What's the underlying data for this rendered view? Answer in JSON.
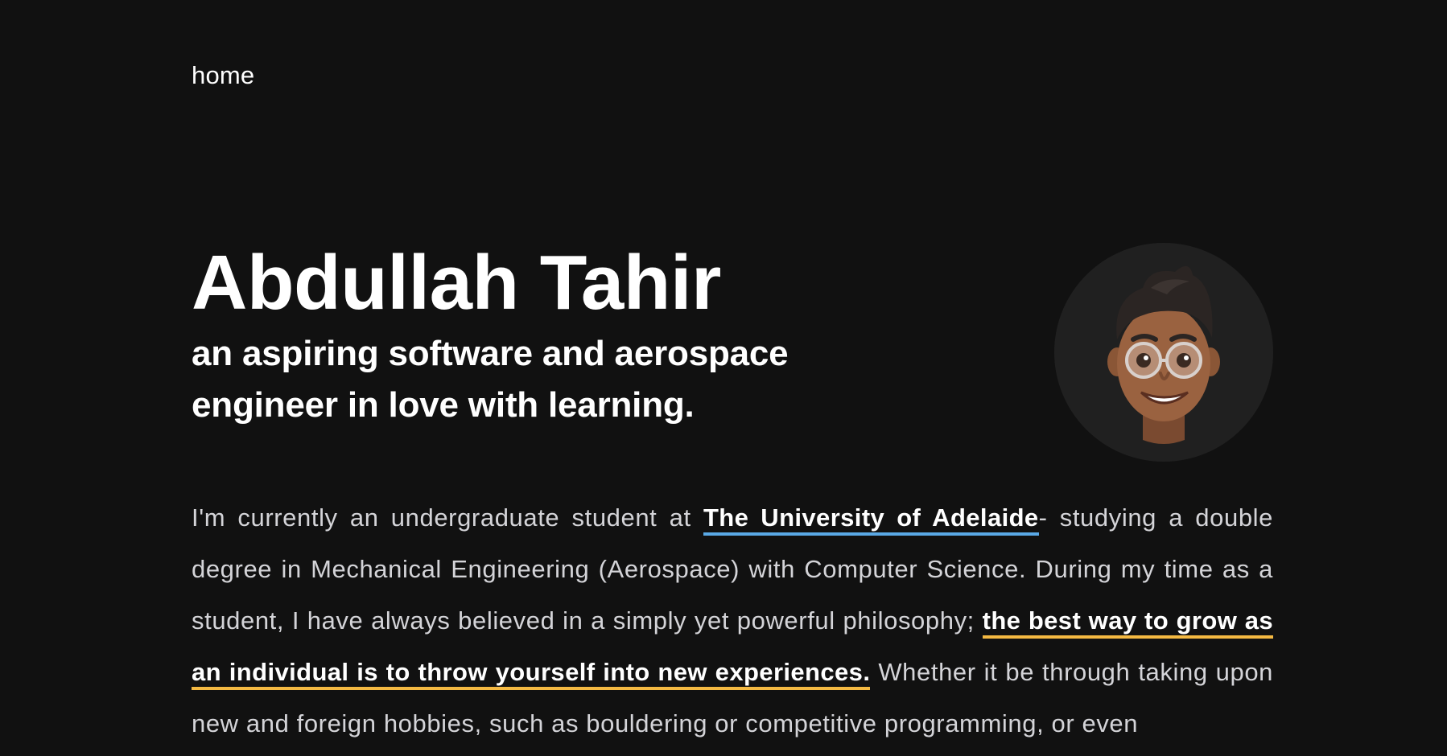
{
  "nav": {
    "home_label": "home"
  },
  "hero": {
    "name": "Abdullah Tahir",
    "tagline": "an aspiring software and aerospace engineer in love with learning."
  },
  "avatar": {
    "icon": "memoji-avatar-icon"
  },
  "bio": {
    "text_1": "I'm currently an undergraduate student at ",
    "link_university": "The University of Adelaide",
    "text_2": "- studying a double degree in Mechanical Engineering (Aerospace) with Computer Science. During my time as a student, I have always believed in a simply yet powerful philosophy; ",
    "link_philosophy": "the best way to grow as an individual is to throw yourself into new experiences.",
    "text_3": " Whether it be through taking upon new and foreign hobbies, such as bouldering or competitive programming, or even"
  },
  "colors": {
    "background": "#111111",
    "text": "#ffffff",
    "body_text": "#d4d4d8",
    "link_underline_blue": "#5aa9e6",
    "link_underline_yellow": "#f4b942",
    "avatar_bg": "#202020"
  }
}
